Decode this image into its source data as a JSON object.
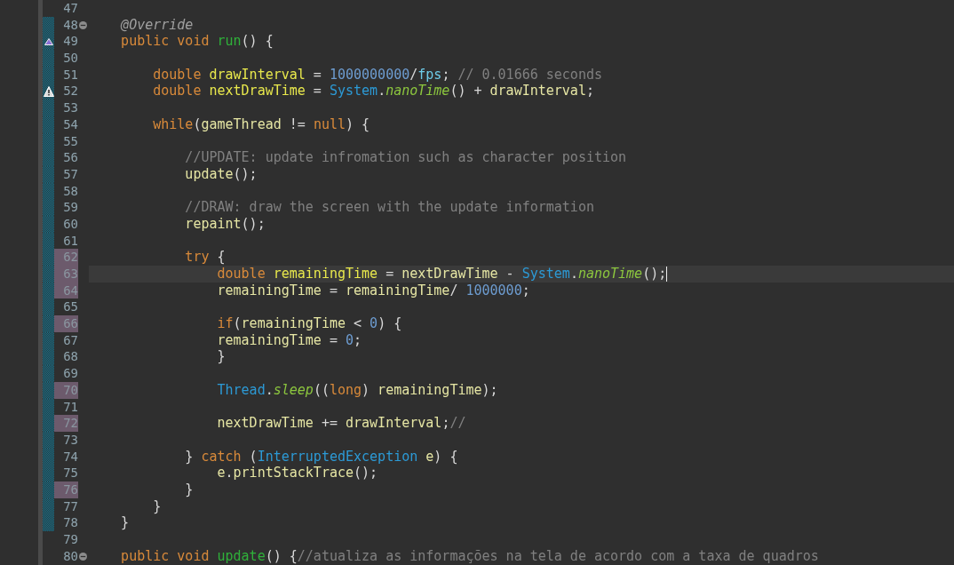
{
  "editor": {
    "lines": [
      {
        "number": "47",
        "changed": false,
        "current": false,
        "in_diff": false,
        "foldable": false
      },
      {
        "number": "48",
        "changed": false,
        "current": false,
        "in_diff": true,
        "foldable": true,
        "tokens": [
          {
            "kind": "ann",
            "text": "    @Override"
          }
        ]
      },
      {
        "number": "49",
        "changed": false,
        "current": false,
        "in_diff": true,
        "foldable": false,
        "marker": {
          "kind": "override"
        },
        "tokens": [
          {
            "kind": "kw",
            "text": "    public"
          },
          {
            "kind": "kw",
            "text": " void"
          },
          {
            "kind": "fn",
            "text": " run"
          },
          {
            "kind": "op",
            "text": "() {"
          }
        ]
      },
      {
        "number": "50",
        "changed": false,
        "current": false,
        "in_diff": true,
        "foldable": false
      },
      {
        "number": "51",
        "changed": false,
        "current": false,
        "in_diff": true,
        "foldable": false,
        "tokens": [
          {
            "kind": "kw",
            "text": "        double"
          },
          {
            "kind": "decl",
            "text": " drawInterval"
          },
          {
            "kind": "op",
            "text": " = "
          },
          {
            "kind": "num",
            "text": "1000000000"
          },
          {
            "kind": "op",
            "text": "/"
          },
          {
            "kind": "field",
            "text": "fps"
          },
          {
            "kind": "op",
            "text": ";"
          },
          {
            "kind": "cmt",
            "text": " // 0.01666 seconds"
          }
        ]
      },
      {
        "number": "52",
        "changed": false,
        "current": false,
        "in_diff": true,
        "foldable": false,
        "marker": {
          "kind": "warning"
        },
        "tokens": [
          {
            "kind": "kw",
            "text": "        double"
          },
          {
            "kind": "decl",
            "text": " nextDrawTime"
          },
          {
            "kind": "op",
            "text": " = "
          },
          {
            "kind": "cls",
            "text": "System"
          },
          {
            "kind": "op",
            "text": "."
          },
          {
            "kind": "call",
            "text": "nanoTime"
          },
          {
            "kind": "op",
            "text": "() + "
          },
          {
            "kind": "var",
            "text": "drawInterval"
          },
          {
            "kind": "op",
            "text": ";"
          }
        ]
      },
      {
        "number": "53",
        "changed": false,
        "current": false,
        "in_diff": true,
        "foldable": false
      },
      {
        "number": "54",
        "changed": false,
        "current": false,
        "in_diff": true,
        "foldable": false,
        "tokens": [
          {
            "kind": "kw",
            "text": "        while"
          },
          {
            "kind": "op",
            "text": "("
          },
          {
            "kind": "var",
            "text": "gameThread"
          },
          {
            "kind": "op",
            "text": " != "
          },
          {
            "kind": "kw",
            "text": "null"
          },
          {
            "kind": "op",
            "text": ") {"
          }
        ]
      },
      {
        "number": "55",
        "changed": false,
        "current": false,
        "in_diff": true,
        "foldable": false
      },
      {
        "number": "56",
        "changed": false,
        "current": false,
        "in_diff": true,
        "foldable": false,
        "tokens": [
          {
            "kind": "cmt",
            "text": "            //UPDATE: update infromation such as character position"
          }
        ]
      },
      {
        "number": "57",
        "changed": false,
        "current": false,
        "in_diff": true,
        "foldable": false,
        "tokens": [
          {
            "kind": "var",
            "text": "            update"
          },
          {
            "kind": "op",
            "text": "();"
          }
        ]
      },
      {
        "number": "58",
        "changed": false,
        "current": false,
        "in_diff": true,
        "foldable": false
      },
      {
        "number": "59",
        "changed": false,
        "current": false,
        "in_diff": true,
        "foldable": false,
        "tokens": [
          {
            "kind": "cmt",
            "text": "            //DRAW: draw the screen with the update information"
          }
        ]
      },
      {
        "number": "60",
        "changed": false,
        "current": false,
        "in_diff": true,
        "foldable": false,
        "tokens": [
          {
            "kind": "var",
            "text": "            repaint"
          },
          {
            "kind": "op",
            "text": "();"
          }
        ]
      },
      {
        "number": "61",
        "changed": false,
        "current": false,
        "in_diff": true,
        "foldable": false
      },
      {
        "number": "62",
        "changed": true,
        "current": false,
        "in_diff": true,
        "foldable": false,
        "tokens": [
          {
            "kind": "kw",
            "text": "            try"
          },
          {
            "kind": "op",
            "text": " {"
          }
        ]
      },
      {
        "number": "63",
        "changed": true,
        "current": true,
        "in_diff": true,
        "foldable": false,
        "tokens": [
          {
            "kind": "kw",
            "text": "                double"
          },
          {
            "kind": "decl",
            "text": " remainingTime"
          },
          {
            "kind": "op",
            "text": " = "
          },
          {
            "kind": "var",
            "text": "nextDrawTime"
          },
          {
            "kind": "op",
            "text": " - "
          },
          {
            "kind": "cls",
            "text": "System"
          },
          {
            "kind": "op",
            "text": "."
          },
          {
            "kind": "call",
            "text": "nanoTime"
          },
          {
            "kind": "op",
            "text": "();"
          }
        ]
      },
      {
        "number": "64",
        "changed": true,
        "current": false,
        "in_diff": true,
        "foldable": false,
        "tokens": [
          {
            "kind": "var",
            "text": "                remainingTime"
          },
          {
            "kind": "op",
            "text": " = "
          },
          {
            "kind": "var",
            "text": "remainingTime"
          },
          {
            "kind": "op",
            "text": "/"
          },
          {
            "kind": "num",
            "text": " 1000000"
          },
          {
            "kind": "op",
            "text": ";"
          }
        ]
      },
      {
        "number": "65",
        "changed": false,
        "current": false,
        "in_diff": true,
        "foldable": false
      },
      {
        "number": "66",
        "changed": true,
        "current": false,
        "in_diff": true,
        "foldable": false,
        "tokens": [
          {
            "kind": "kw",
            "text": "                if"
          },
          {
            "kind": "op",
            "text": "("
          },
          {
            "kind": "var",
            "text": "remainingTime"
          },
          {
            "kind": "op",
            "text": " < "
          },
          {
            "kind": "num",
            "text": "0"
          },
          {
            "kind": "op",
            "text": ") {"
          }
        ]
      },
      {
        "number": "67",
        "changed": false,
        "current": false,
        "in_diff": true,
        "foldable": false,
        "tokens": [
          {
            "kind": "var",
            "text": "                remainingTime"
          },
          {
            "kind": "op",
            "text": " = "
          },
          {
            "kind": "num",
            "text": "0"
          },
          {
            "kind": "op",
            "text": ";"
          }
        ]
      },
      {
        "number": "68",
        "changed": false,
        "current": false,
        "in_diff": true,
        "foldable": false,
        "tokens": [
          {
            "kind": "op",
            "text": "                }"
          }
        ]
      },
      {
        "number": "69",
        "changed": false,
        "current": false,
        "in_diff": true,
        "foldable": false
      },
      {
        "number": "70",
        "changed": true,
        "current": false,
        "in_diff": true,
        "foldable": false,
        "tokens": [
          {
            "kind": "cls",
            "text": "                Thread"
          },
          {
            "kind": "op",
            "text": "."
          },
          {
            "kind": "call",
            "text": "sleep"
          },
          {
            "kind": "op",
            "text": "(("
          },
          {
            "kind": "kw",
            "text": "long"
          },
          {
            "kind": "op",
            "text": ")"
          },
          {
            "kind": "var",
            "text": " remainingTime"
          },
          {
            "kind": "op",
            "text": ");"
          }
        ]
      },
      {
        "number": "71",
        "changed": false,
        "current": false,
        "in_diff": true,
        "foldable": false
      },
      {
        "number": "72",
        "changed": true,
        "current": false,
        "in_diff": true,
        "foldable": false,
        "tokens": [
          {
            "kind": "var",
            "text": "                nextDrawTime"
          },
          {
            "kind": "op",
            "text": " += "
          },
          {
            "kind": "var",
            "text": "drawInterval"
          },
          {
            "kind": "op",
            "text": ";"
          },
          {
            "kind": "cmt",
            "text": "//"
          }
        ]
      },
      {
        "number": "73",
        "changed": false,
        "current": false,
        "in_diff": true,
        "foldable": false
      },
      {
        "number": "74",
        "changed": false,
        "current": false,
        "in_diff": true,
        "foldable": false,
        "tokens": [
          {
            "kind": "op",
            "text": "            }"
          },
          {
            "kind": "kw",
            "text": " catch"
          },
          {
            "kind": "op",
            "text": " ("
          },
          {
            "kind": "cls",
            "text": "InterruptedException"
          },
          {
            "kind": "var",
            "text": " e"
          },
          {
            "kind": "op",
            "text": ") {"
          }
        ]
      },
      {
        "number": "75",
        "changed": false,
        "current": false,
        "in_diff": true,
        "foldable": false,
        "tokens": [
          {
            "kind": "var",
            "text": "                e"
          },
          {
            "kind": "op",
            "text": "."
          },
          {
            "kind": "var",
            "text": "printStackTrace"
          },
          {
            "kind": "op",
            "text": "();"
          }
        ]
      },
      {
        "number": "76",
        "changed": true,
        "current": false,
        "in_diff": true,
        "foldable": false,
        "tokens": [
          {
            "kind": "op",
            "text": "            }"
          }
        ]
      },
      {
        "number": "77",
        "changed": false,
        "current": false,
        "in_diff": true,
        "foldable": false,
        "tokens": [
          {
            "kind": "op",
            "text": "        }"
          }
        ]
      },
      {
        "number": "78",
        "changed": false,
        "current": false,
        "in_diff": true,
        "foldable": false,
        "tokens": [
          {
            "kind": "op",
            "text": "    }"
          }
        ]
      },
      {
        "number": "79",
        "changed": false,
        "current": false,
        "in_diff": false,
        "foldable": false
      },
      {
        "number": "80",
        "changed": false,
        "current": false,
        "in_diff": false,
        "foldable": true,
        "tokens": [
          {
            "kind": "kw",
            "text": "    public"
          },
          {
            "kind": "kw",
            "text": " void"
          },
          {
            "kind": "fn",
            "text": " update"
          },
          {
            "kind": "op",
            "text": "() {"
          },
          {
            "kind": "cmt",
            "text": "//atualiza as informações na tela de acordo com a taxa de quadros"
          }
        ]
      }
    ]
  }
}
